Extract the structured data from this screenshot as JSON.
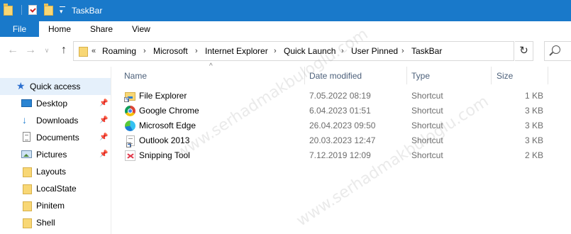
{
  "window": {
    "title": "TaskBar"
  },
  "ribbon": {
    "file_label": "File",
    "tabs": [
      "Home",
      "Share",
      "View"
    ]
  },
  "address": {
    "overflow_glyph": "«",
    "crumbs": [
      "Roaming",
      "Microsoft",
      "Internet Explorer",
      "Quick Launch",
      "User Pinned",
      "TaskBar"
    ]
  },
  "nav": {
    "items": [
      {
        "label": "Quick access",
        "icon": "star-icon"
      },
      {
        "label": "Desktop",
        "icon": "desktop-icon",
        "pinned": true
      },
      {
        "label": "Downloads",
        "icon": "download-icon",
        "pinned": true
      },
      {
        "label": "Documents",
        "icon": "document-icon",
        "pinned": true
      },
      {
        "label": "Pictures",
        "icon": "pictures-icon",
        "pinned": true
      },
      {
        "label": "Layouts",
        "icon": "folder-icon"
      },
      {
        "label": "LocalState",
        "icon": "folder-icon"
      },
      {
        "label": "Pinitem",
        "icon": "folder-icon"
      },
      {
        "label": "Shell",
        "icon": "folder-icon"
      }
    ]
  },
  "columns": {
    "name": "Name",
    "date": "Date modified",
    "type": "Type",
    "size": "Size"
  },
  "files": [
    {
      "name": "File Explorer",
      "date": "7.05.2022 08:19",
      "type": "Shortcut",
      "size": "1 KB",
      "icon": "file-explorer-icon"
    },
    {
      "name": "Google Chrome",
      "date": "6.04.2023 01:51",
      "type": "Shortcut",
      "size": "3 KB",
      "icon": "chrome-icon"
    },
    {
      "name": "Microsoft Edge",
      "date": "26.04.2023 09:50",
      "type": "Shortcut",
      "size": "3 KB",
      "icon": "edge-icon"
    },
    {
      "name": "Outlook 2013",
      "date": "20.03.2023 12:47",
      "type": "Shortcut",
      "size": "3 KB",
      "icon": "outlook-icon"
    },
    {
      "name": "Snipping Tool",
      "date": "7.12.2019 12:09",
      "type": "Shortcut",
      "size": "2 KB",
      "icon": "snipping-tool-icon"
    }
  ],
  "watermark": "www.serhadmakbuloglu.com",
  "colors": {
    "titlebar": "#1979ca",
    "selection": "#e5f0fb",
    "header_text": "#4c607a"
  }
}
